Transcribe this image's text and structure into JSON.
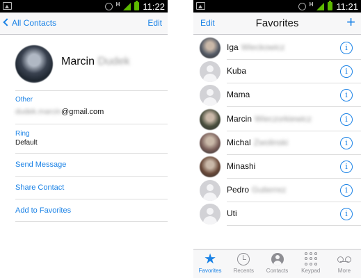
{
  "status_bar": {
    "time": "11:22",
    "time_right": "11:21",
    "network": "H"
  },
  "detail": {
    "back_label": "All Contacts",
    "edit_label": "Edit",
    "first_name": "Marcin",
    "last_name": "Dudek",
    "other_label": "Other",
    "email_user": "dudek.marcin",
    "email_domain": "@gmail.com",
    "ring_label": "Ring",
    "ring_value": "Default",
    "actions": [
      "Send Message",
      "Share Contact",
      "Add to Favorites"
    ]
  },
  "favorites": {
    "edit_label": "Edit",
    "title": "Favorites",
    "add_icon": "plus-icon",
    "items": [
      {
        "first": "Iga",
        "last": "Wieckowicz",
        "avatar": "photo",
        "color": "#555b66"
      },
      {
        "first": "Kuba",
        "last": "",
        "avatar": "default",
        "color": "#d2d2d6"
      },
      {
        "first": "Mama",
        "last": "",
        "avatar": "default",
        "color": "#d2d2d6"
      },
      {
        "first": "Marcin",
        "last": "Wieczorkiewicz",
        "avatar": "photo",
        "color": "#4a4f3e"
      },
      {
        "first": "Michal",
        "last": "Zwolinski",
        "avatar": "photo",
        "color": "#7a5f5a"
      },
      {
        "first": "Minashi",
        "last": "",
        "avatar": "photo",
        "color": "#6a4a3a"
      },
      {
        "first": "Pedro",
        "last": "Gutierrez",
        "avatar": "default",
        "color": "#d2d2d6"
      },
      {
        "first": "Uti",
        "last": "",
        "avatar": "default",
        "color": "#d2d2d6"
      }
    ],
    "tabs": [
      {
        "label": "Favorites",
        "icon": "star-icon",
        "active": true
      },
      {
        "label": "Recents",
        "icon": "clock-icon",
        "active": false
      },
      {
        "label": "Contacts",
        "icon": "person-icon",
        "active": false
      },
      {
        "label": "Keypad",
        "icon": "keypad-icon",
        "active": false
      },
      {
        "label": "More",
        "icon": "voicemail-icon",
        "active": false
      }
    ]
  },
  "colors": {
    "accent": "#1a82e6",
    "separator": "#dcdcdc",
    "status_green": "#5cb800"
  }
}
